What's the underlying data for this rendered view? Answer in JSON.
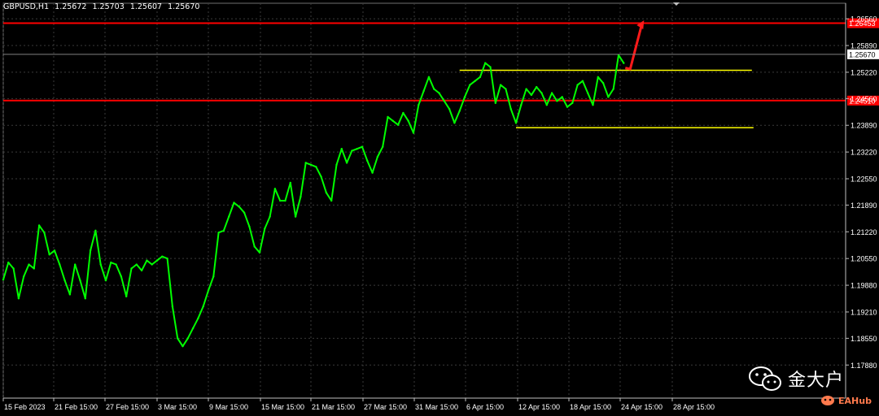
{
  "header": {
    "symbol": "GBPUSD,H1",
    "open": "1.25672",
    "high": "1.25703",
    "low": "1.25607",
    "close": "1.25670"
  },
  "watermark": {
    "text": "金大户",
    "sub": "EAHub"
  },
  "colors": {
    "background": "#000000",
    "price_line": "#00ff00",
    "resistance": "#ff0000",
    "channel": "#ffff00",
    "arrow": "#ff1a1a",
    "grid": "#3a3a3a",
    "axis": "#bfbfbf"
  },
  "chart_data": {
    "type": "line",
    "title": "",
    "xlabel": "",
    "ylabel": "",
    "ylim": [
      1.1705,
      1.2695
    ],
    "grid": true,
    "x_ticks": [
      "15 Feb 2023",
      "21 Feb 15:00",
      "27 Feb 15:00",
      "3 Mar 15:00",
      "9 Mar 15:00",
      "15 Mar 15:00",
      "21 Mar 15:00",
      "27 Mar 15:00",
      "31 Mar 15:00",
      "6 Apr 15:00",
      "12 Apr 15:00",
      "18 Apr 15:00",
      "24 Apr 15:00",
      "28 Apr 15:00"
    ],
    "y_ticks": [
      1.2656,
      1.2589,
      1.2522,
      1.2456,
      1.2389,
      1.2322,
      1.2255,
      1.2189,
      1.2122,
      1.2055,
      1.1988,
      1.1921,
      1.1855,
      1.1788
    ],
    "current_price": "1.25670",
    "levels": [
      {
        "name": "resistance",
        "value": 1.2645,
        "label": "1.26453"
      },
      {
        "name": "support",
        "value": 1.2451,
        "label": "1.24510"
      }
    ],
    "channel": {
      "upper": 1.2527,
      "lower": 1.2383,
      "from_bar": 89,
      "to_bar": 146
    },
    "series": [
      {
        "values": [
          1.2002,
          1.2045,
          1.203,
          1.1955,
          1.201,
          1.204,
          1.203,
          1.2138,
          1.212,
          1.2065,
          1.2075,
          1.204,
          1.2,
          1.1965,
          1.204,
          1.2,
          1.1955,
          1.2075,
          1.2125,
          1.204,
          1.2,
          1.2045,
          1.204,
          1.201,
          1.196,
          1.203,
          1.204,
          1.2025,
          1.205,
          1.204,
          1.205,
          1.206,
          1.2055,
          1.1935,
          1.1855,
          1.1835,
          1.1855,
          1.188,
          1.1905,
          1.1935,
          1.1975,
          1.201,
          1.212,
          1.2125,
          1.216,
          1.2195,
          1.2185,
          1.217,
          1.2135,
          1.2085,
          1.207,
          1.213,
          1.216,
          1.223,
          1.22,
          1.22,
          1.2245,
          1.216,
          1.221,
          1.2295,
          1.229,
          1.2285,
          1.226,
          1.222,
          1.22,
          1.229,
          1.233,
          1.2295,
          1.2325,
          1.233,
          1.2335,
          1.23,
          1.227,
          1.231,
          1.2335,
          1.241,
          1.24,
          1.239,
          1.242,
          1.24,
          1.237,
          1.244,
          1.2475,
          1.251,
          1.248,
          1.247,
          1.245,
          1.243,
          1.2395,
          1.2425,
          1.246,
          1.249,
          1.25,
          1.251,
          1.2545,
          1.2535,
          1.2445,
          1.249,
          1.248,
          1.243,
          1.2395,
          1.244,
          1.248,
          1.2465,
          1.2485,
          1.247,
          1.244,
          1.247,
          1.245,
          1.246,
          1.2435,
          1.2445,
          1.249,
          1.25,
          1.247,
          1.244,
          1.251,
          1.2495,
          1.246,
          1.248,
          1.2565,
          1.2545
        ]
      }
    ]
  }
}
